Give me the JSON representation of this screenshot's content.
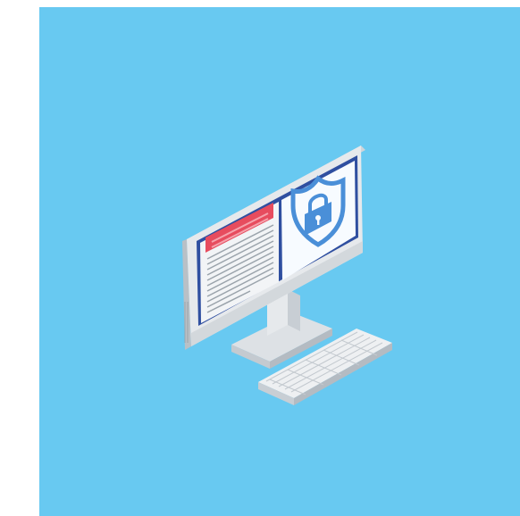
{
  "scene": {
    "subject": "computer-security-illustration",
    "icons": [
      "desktop-monitor-icon",
      "shield-lock-icon",
      "keyboard-icon"
    ],
    "colors": {
      "background": "#68c9f1",
      "frame": "#ffffff",
      "monitor_body": "#e6e9ec",
      "monitor_shadow": "#b9c0c6",
      "screen_bezel": "#2f4fa0",
      "screen_right": "#f7fbff",
      "document_header": "#e74c5e",
      "document_lines": "#9aa3ab",
      "shield": "#4a8fd8",
      "keyboard": "#eef0f2"
    }
  }
}
